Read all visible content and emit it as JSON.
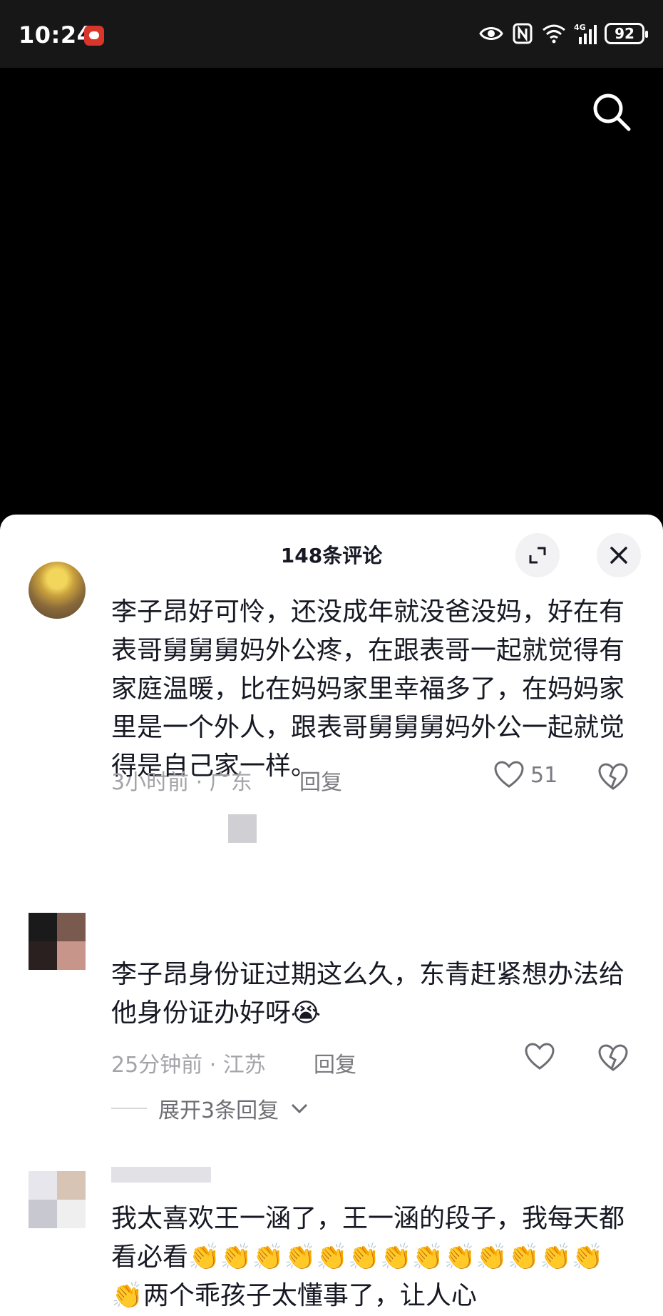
{
  "status_bar": {
    "time": "10:24",
    "battery": "92",
    "icons": [
      "eye-icon",
      "nfc-icon",
      "wifi-icon",
      "signal-4g-icon",
      "battery-icon"
    ]
  },
  "header": {
    "comment_count_title": "148条评论"
  },
  "comments": [
    {
      "text": "李子昂好可怜，还没成年就没爸没妈，好在有表哥舅舅舅妈外公疼，在跟表哥一起就觉得有家庭温暖，比在妈妈家里幸福多了，在妈妈家里是一个外人，跟表哥舅舅舅妈外公一起就觉得是自己家一样。",
      "meta": "3小时前 · 广东",
      "reply_label": "回复",
      "likes": "51"
    },
    {
      "text": "李子昂身份证过期这么久，东青赶紧想办法给他身份证办好呀😭",
      "meta": "25分钟前 · 江苏",
      "reply_label": "回复",
      "likes": "",
      "expand_label": "展开3条回复"
    },
    {
      "text": "我太喜欢王一涵了，王一涵的段子，我每天都看必看👏👏👏👏👏👏👏👏👏👏👏👏👏👏两个乖孩子太懂事了，让人心"
    }
  ],
  "colors": {
    "status_bg": "#171717",
    "sheet_bg": "#ffffff",
    "text_primary": "#161823",
    "text_secondary": "#a3a3a8"
  }
}
